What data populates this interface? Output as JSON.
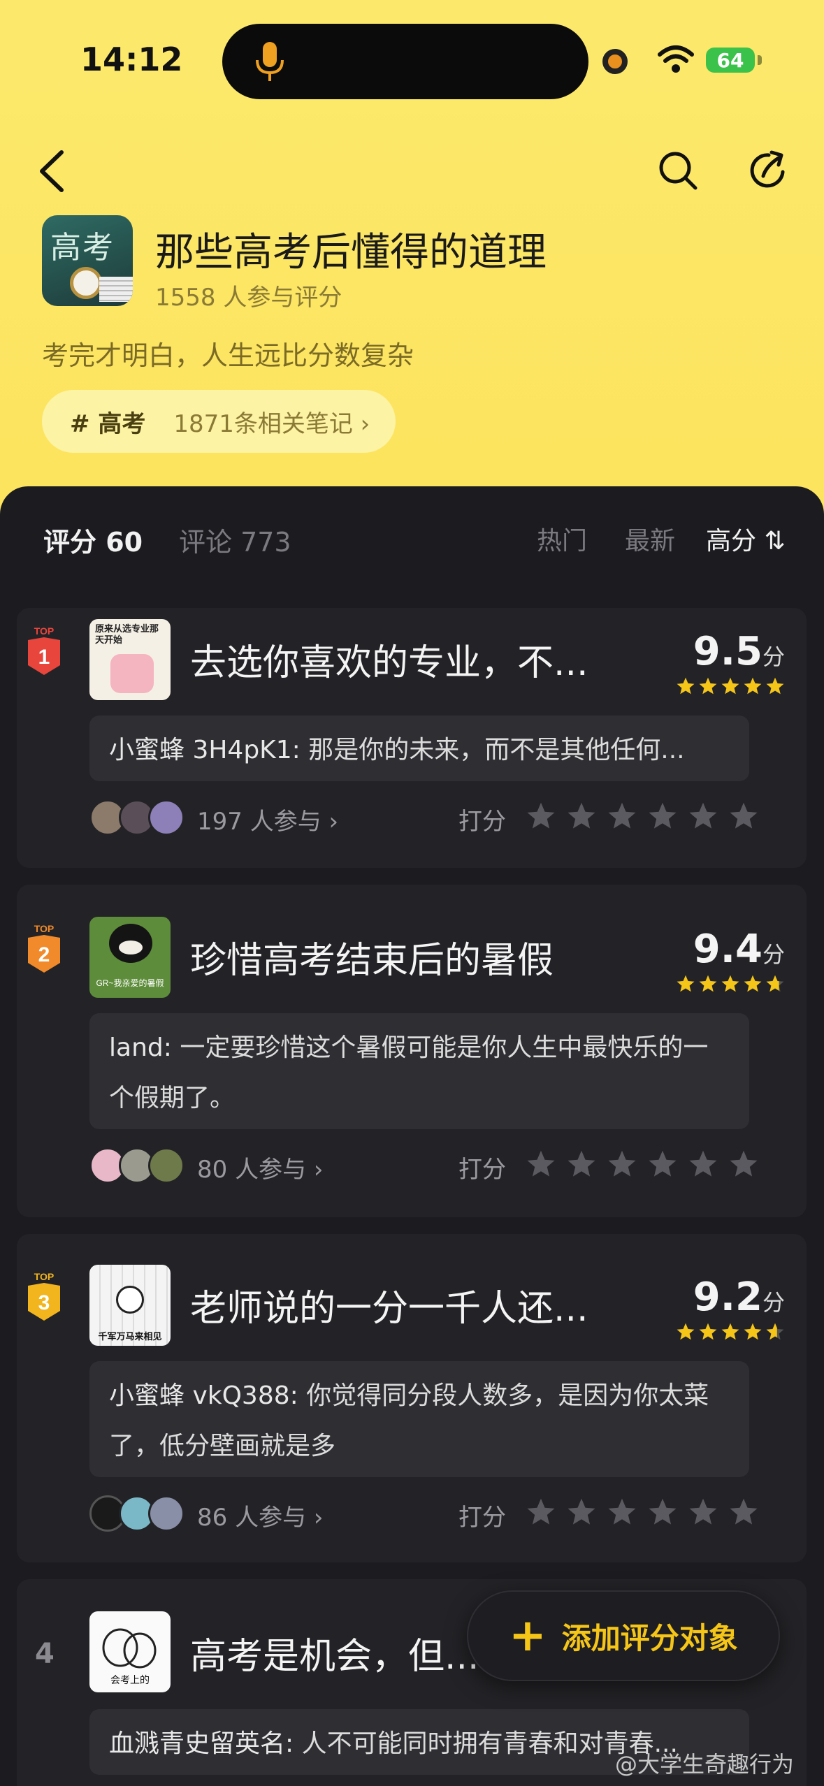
{
  "status": {
    "time": "14:12",
    "battery": "64"
  },
  "topic": {
    "title": "那些高考后懂得的道理",
    "participants": "1558 人参与评分",
    "description": "考完才明白，人生远比分数复杂",
    "cover_text": "高考",
    "tag": "# 高考",
    "tag_notes": "1871条相关笔记 ›"
  },
  "tabs": {
    "rating": "评分 60",
    "comments": "评论 773"
  },
  "sort": {
    "hot": "热门",
    "newest": "最新",
    "highest": "高分 ⇅"
  },
  "items": [
    {
      "rank": "1",
      "rank_badge": "TOP",
      "title": "去选你喜欢的专业，不...",
      "score": "9.5",
      "unit": "分",
      "stars": 5,
      "thumb_text": "原来从选专业那天开始",
      "comment_user": "小蜜蜂 3H4pK1:",
      "comment_text": "那是你的未来，而不是其他任何...",
      "participants": "197 人参与 ›",
      "rate_label": "打分"
    },
    {
      "rank": "2",
      "rank_badge": "TOP",
      "title": "珍惜高考结束后的暑假",
      "score": "9.4",
      "unit": "分",
      "stars": 4.7,
      "thumb_text": "GR~我亲爱的暑假",
      "comment_user": "land:",
      "comment_text": "一定要珍惜这个暑假可能是你人生中最快乐的一个假期了。",
      "participants": "80 人参与 ›",
      "rate_label": "打分"
    },
    {
      "rank": "3",
      "rank_badge": "TOP",
      "title": "老师说的一分一千人还...",
      "score": "9.2",
      "unit": "分",
      "stars": 4.6,
      "thumb_text": "千军万马来相见",
      "comment_user": "小蜜蜂 vkQ388:",
      "comment_text": "你觉得同分段人数多，是因为你太菜了，低分壁画就是多",
      "participants": "86 人参与 ›",
      "rate_label": "打分"
    },
    {
      "rank": "4",
      "title": "高考是机会，但...",
      "thumb_text": "会考上的",
      "comment_user": "血溅青史留英名:",
      "comment_text": "人不可能同时拥有青春和对青春..."
    }
  ],
  "fab": {
    "plus": "+",
    "label": "添加评分对象"
  },
  "watermark": "@大学生奇趣行为",
  "colors": {
    "accent": "#f5c518",
    "panel": "#1c1c20",
    "rank1": "#e8453c",
    "rank2": "#f08a2a",
    "rank3": "#f2b51e"
  }
}
